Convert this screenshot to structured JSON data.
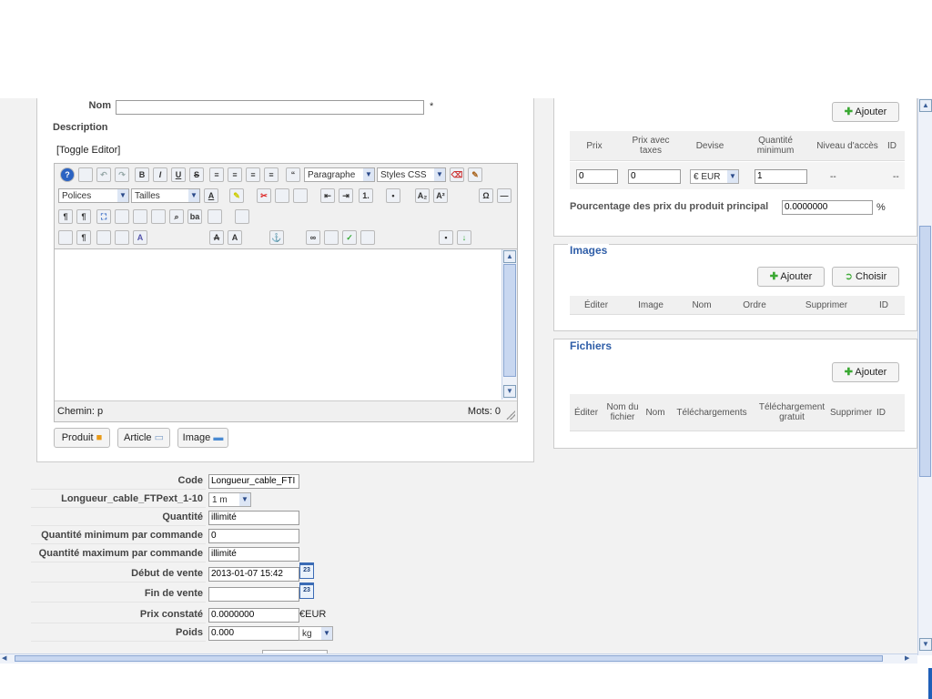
{
  "editor": {
    "nom_label": "Nom",
    "required_mark": "*",
    "description_label": "Description",
    "toggle_editor": "[Toggle Editor]",
    "paragraph_select": "Paragraphe",
    "styles_select": "Styles CSS",
    "fonts_select": "Polices",
    "sizes_select": "Tailles",
    "path_label": "Chemin: p",
    "word_count": "Mots: 0",
    "buttons": {
      "produit": "Produit",
      "article": "Article",
      "image": "Image"
    }
  },
  "product_fields": [
    {
      "label": "Code",
      "value": "Longueur_cable_FTI",
      "type": "text"
    },
    {
      "label": "Longueur_cable_FTPext_1-10",
      "value": "1 m",
      "type": "select"
    },
    {
      "label": "Quantité",
      "value": "illimité",
      "type": "text"
    },
    {
      "label": "Quantité minimum par commande",
      "value": "0",
      "type": "text"
    },
    {
      "label": "Quantité maximum par commande",
      "value": "illimité",
      "type": "text"
    },
    {
      "label": "Début de vente",
      "value": "2013-01-07 15:42",
      "type": "date"
    },
    {
      "label": "Fin de vente",
      "value": "",
      "type": "date"
    },
    {
      "label": "Prix constaté",
      "value": "0.0000000",
      "type": "price",
      "suffix": "€EUR"
    },
    {
      "label": "Poids",
      "value": "0.000",
      "type": "unit",
      "unit": "kg"
    }
  ],
  "prices": {
    "add_label": "Ajouter",
    "headers": [
      "Prix",
      "Prix avec taxes",
      "Devise",
      "Quantité minimum",
      "Niveau d'accès",
      "ID"
    ],
    "row": {
      "prix": "0",
      "prix_taxes": "0",
      "devise": "€ EUR",
      "quantite_min": "1",
      "niveau": "--",
      "id": "--"
    },
    "percentage_label": "Pourcentage des prix du produit principal",
    "percentage_value": "0.0000000",
    "percentage_unit": "%"
  },
  "images": {
    "title": "Images",
    "add_label": "Ajouter",
    "choose_label": "Choisir",
    "headers": [
      "Éditer",
      "Image",
      "Nom",
      "Ordre",
      "Supprimer",
      "ID"
    ]
  },
  "files": {
    "title": "Fichiers",
    "add_label": "Ajouter",
    "headers": [
      "Éditer",
      "Nom du fichier",
      "Nom",
      "Téléchargements",
      "Téléchargement gratuit",
      "Supprimer",
      "ID"
    ]
  },
  "colors": {
    "accent": "#2f5ea8",
    "panel_bg": "#f2f2f2",
    "add_icon": "#3aa832"
  }
}
